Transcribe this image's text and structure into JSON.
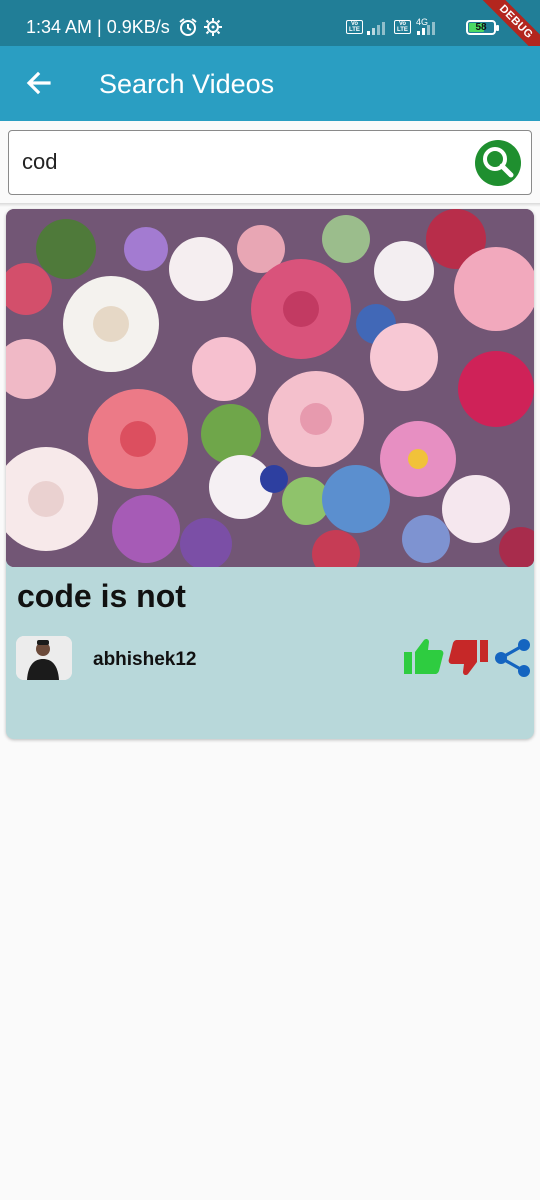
{
  "status_bar": {
    "time_and_speed": "1:34 AM | 0.9KB/s",
    "network_label": "4G",
    "volte_label": "Vo LTE",
    "battery_level": "58",
    "icons": [
      "alarm-icon",
      "settings-gear-icon",
      "volte-icon",
      "signal-icon",
      "battery-icon"
    ]
  },
  "debug_banner": "DEBUG",
  "app_bar": {
    "title": "Search Videos",
    "back_icon": "arrow-back-icon"
  },
  "search": {
    "value": "cod",
    "button_icon": "search-icon"
  },
  "results": [
    {
      "title": "code is not",
      "username": "abhishek12",
      "thumbnail": "flowers-image",
      "actions": [
        "thumbs-up-icon",
        "thumbs-down-icon",
        "share-icon"
      ]
    }
  ],
  "colors": {
    "status_bar": "#217e97",
    "app_bar": "#2a9ec2",
    "card": "#b8d8da",
    "search_button": "#1f8f2f",
    "like": "#2ecc40",
    "dislike": "#c62828",
    "share": "#1565c0",
    "debug": "#b3261e"
  }
}
